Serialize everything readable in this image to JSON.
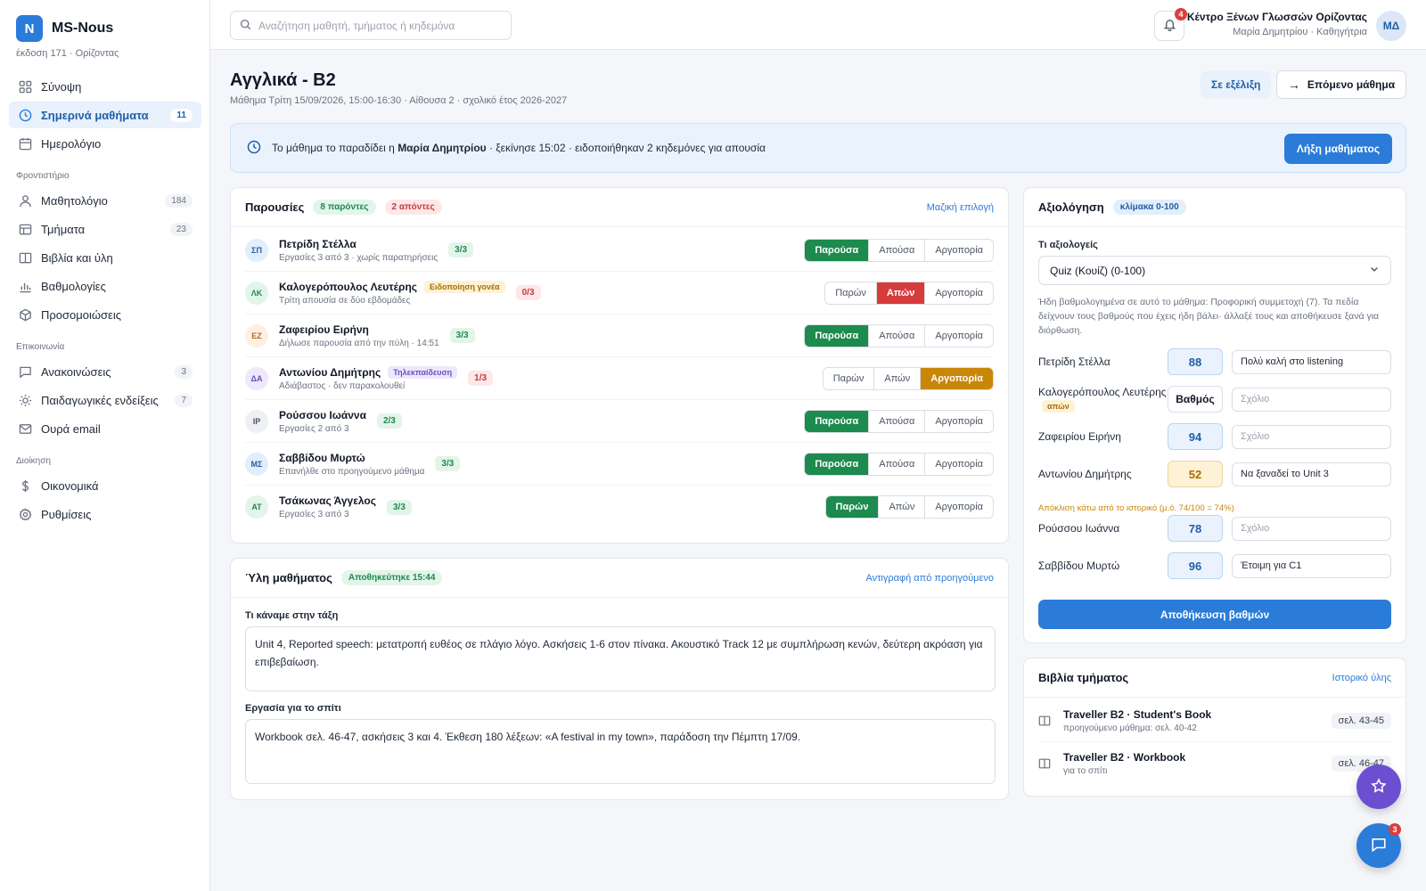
{
  "brand": {
    "logo_letter": "N",
    "name": "MS-Nous",
    "subtitle": "έκδοση 171 · Ορίζοντας"
  },
  "sidebar": {
    "items": [
      {
        "label": "Σύνοψη",
        "icon": "dashboard-icon",
        "count": ""
      },
      {
        "label": "Σημερινά μαθήματα",
        "icon": "clock-icon",
        "count": "11",
        "active": true
      },
      {
        "label": "Ημερολόγιο",
        "icon": "calendar-icon",
        "count": ""
      },
      {
        "label": "Μαθητολόγιο",
        "icon": "user-icon",
        "count": "184"
      },
      {
        "label": "Τμήματα",
        "icon": "grid-icon",
        "count": "23"
      },
      {
        "label": "Βιβλία και ύλη",
        "icon": "book-icon",
        "count": ""
      },
      {
        "label": "Βαθμολογίες",
        "icon": "bar-chart-icon",
        "count": ""
      },
      {
        "label": "Προσομοιώσεις",
        "icon": "cube-icon",
        "count": ""
      },
      {
        "label": "Ανακοινώσεις",
        "icon": "message-icon",
        "count": "3"
      },
      {
        "label": "Παιδαγωγικές ενδείξεις",
        "icon": "sun-icon",
        "count": "7"
      },
      {
        "label": "Ουρά email",
        "icon": "mail-icon",
        "count": ""
      },
      {
        "label": "Οικονομικά",
        "icon": "dollar-icon",
        "count": ""
      },
      {
        "label": "Ρυθμίσεις",
        "icon": "gear-icon",
        "count": ""
      }
    ],
    "sections": [
      "Φροντιστήριο",
      "Επικοινωνία",
      "Διοίκηση"
    ]
  },
  "topbar": {
    "search_placeholder": "Αναζήτηση μαθητή, τμήματος ή κηδεμόνα",
    "notifications_count": "4",
    "org_name": "Κέντρο Ξένων Γλωσσών Ορίζοντας",
    "user_line": "Μαρία Δημητρίου · Καθηγήτρια",
    "avatar_initials": "ΜΔ"
  },
  "header": {
    "title": "Αγγλικά - B2",
    "subtitle": "Μάθημα Τρίτη 15/09/2026, 15:00-16:30 · Αίθουσα 2 · σχολικό έτος 2026-2027",
    "status": "Σε εξέλιξη",
    "next_button": "Επόμενο μάθημα"
  },
  "banner": {
    "prefix": "Το μάθημα το παραδίδει η ",
    "teacher": "Μαρία Δημητρίου",
    "suffix": " · ξεκίνησε 15:02 · ειδοποιήθηκαν 2 κηδεμόνες για απουσία",
    "end_button": "Λήξη μαθήματος"
  },
  "attendance": {
    "title": "Παρουσίες",
    "present_chip": "8 παρόντες",
    "absent_chip": "2 απόντες",
    "bulk_link": "Μαζική επιλογή",
    "students": [
      {
        "initials": "ΣΠ",
        "name": "Πετρίδη Στέλλα",
        "tag": "",
        "note": "Εργασίες 3 από 3 · χωρίς παρατηρήσεις",
        "score": "3/3",
        "score_color": "green",
        "options": [
          "Παρούσα",
          "Απούσα",
          "Αργοπορία"
        ],
        "selected": 0
      },
      {
        "initials": "ΛΚ",
        "name": "Καλογερόπουλος Λευτέρης",
        "tag": "Ειδοποίηση γονέα",
        "tag_color": "amber",
        "note": "Τρίτη απουσία σε δύο εβδομάδες",
        "score": "0/3",
        "score_color": "red",
        "options": [
          "Παρών",
          "Απών",
          "Αργοπορία"
        ],
        "selected": 1
      },
      {
        "initials": "ΕΖ",
        "name": "Ζαφειρίου Ειρήνη",
        "tag": "",
        "note": "Δήλωσε παρουσία από την πύλη · 14:51",
        "score": "3/3",
        "score_color": "green",
        "options": [
          "Παρούσα",
          "Απούσα",
          "Αργοπορία"
        ],
        "selected": 0
      },
      {
        "initials": "ΔΑ",
        "name": "Αντωνίου Δημήτρης",
        "tag": "Τηλεκπαίδευση",
        "tag_color": "purple",
        "note": "Αδιάβαστος · δεν παρακολουθεί",
        "score": "1/3",
        "score_color": "red",
        "options": [
          "Παρών",
          "Απών",
          "Αργοπορία"
        ],
        "selected": 2
      },
      {
        "initials": "ΙΡ",
        "name": "Ρούσσου Ιωάννα",
        "tag": "",
        "note": "Εργασίες 2 από 3",
        "score": "2/3",
        "score_color": "green",
        "options": [
          "Παρούσα",
          "Απούσα",
          "Αργοπορία"
        ],
        "selected": 0
      },
      {
        "initials": "ΜΣ",
        "name": "Σαββίδου Μυρτώ",
        "tag": "",
        "note": "Επανήλθε στο προηγούμενο μάθημα",
        "score": "3/3",
        "score_color": "green",
        "options": [
          "Παρούσα",
          "Απούσα",
          "Αργοπορία"
        ],
        "selected": 0
      },
      {
        "initials": "ΑΤ",
        "name": "Τσάκωνας Άγγελος",
        "tag": "",
        "note": "Εργασίες 3 από 3",
        "score": "3/3",
        "score_color": "green",
        "options": [
          "Παρών",
          "Απών",
          "Αργοπορία"
        ],
        "selected": 0
      }
    ]
  },
  "material": {
    "title": "Ύλη μαθήματος",
    "saved_chip": "Αποθηκεύτηκε 15:44",
    "copy_link": "Αντιγραφή από προηγούμενο",
    "class_label": "Τι κάναμε στην τάξη",
    "class_text": "Unit 4, Reported speech: μετατροπή ευθέος σε πλάγιο λόγο. Ασκήσεις 1-6 στον πίνακα. Ακουστικό Track 12 με συμπλήρωση κενών, δεύτερη ακρόαση για επιβεβαίωση.",
    "homework_label": "Εργασία για το σπίτι",
    "homework_text": "Workbook σελ. 46-47, ασκήσεις 3 και 4. Έκθεση 180 λέξεων: «A festival in my town», παράδοση την Πέμπτη 17/09."
  },
  "grading": {
    "title": "Αξιολόγηση",
    "scale_chip": "κλίμακα 0-100",
    "select_label": "Τι αξιολογείς",
    "select_value": "Quiz (Κουίζ) (0-100)",
    "help": "Ήδη βαθμολογημένα σε αυτό το μάθημα: Προφορική συμμετοχή (7). Τα πεδία δείχνουν τους βαθμούς που έχεις ήδη βάλει· άλλαξέ τους και αποθήκευσε ξανά για διόρθωση.",
    "rows": [
      {
        "name": "Πετρίδη Στέλλα",
        "sub": "",
        "grade": "88",
        "comment": "Πολύ καλή στο listening",
        "state": "normal"
      },
      {
        "name": "Καλογερόπουλος Λευτέρης",
        "sub": "απών",
        "grade": "Βαθμός",
        "comment": "Σχόλιο",
        "state": "empty"
      },
      {
        "name": "Ζαφειρίου Ειρήνη",
        "sub": "",
        "grade": "94",
        "comment": "Σχόλιο",
        "state": "normal"
      },
      {
        "name": "Αντωνίου Δημήτρης",
        "sub": "",
        "grade": "52",
        "comment": "Να ξαναδεί το Unit 3",
        "state": "warn"
      },
      {
        "name": "Ρούσσου Ιωάννα",
        "sub": "",
        "grade": "78",
        "comment": "Σχόλιο",
        "state": "normal"
      },
      {
        "name": "Σαββίδου Μυρτώ",
        "sub": "",
        "grade": "96",
        "comment": "Έτοιμη για C1",
        "state": "normal"
      }
    ],
    "warning": "Απόκλιση κάτω από το ιστορικό (μ.ό. 74/100 = 74%)",
    "save_button": "Αποθήκευση βαθμών"
  },
  "books": {
    "title": "Βιβλία τμήματος",
    "history_link": "Ιστορικό ύλης",
    "items": [
      {
        "title": "Traveller B2 · Student's Book",
        "sub": "προηγούμενο μάθημα: σελ. 40-42",
        "pages": "σελ. 43-45"
      },
      {
        "title": "Traveller B2 · Workbook",
        "sub": "για το σπίτι",
        "pages": "σελ. 46-47"
      }
    ]
  },
  "fab": {
    "chat_badge": "3"
  },
  "colors": {
    "accent": "#2b7bd9",
    "present": "#1d8a4e",
    "absent": "#d63c3c",
    "late": "#c98707"
  }
}
